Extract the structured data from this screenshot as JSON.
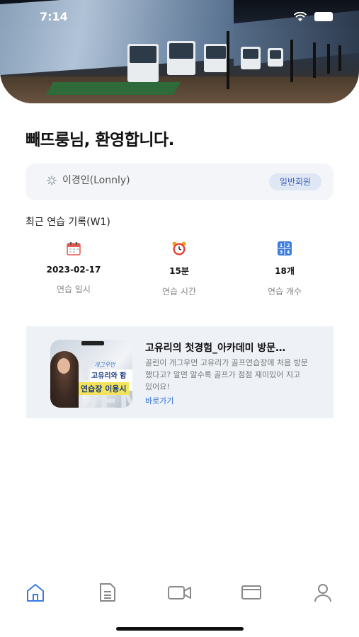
{
  "status_bar": {
    "time": "7:14",
    "wifi_icon": "wifi-icon",
    "battery_icon": "battery-icon"
  },
  "hero": {
    "image": "golf-practice-range-photo"
  },
  "greeting": "빼뜨룽님, 환영합니다.",
  "profile": {
    "name": "이경인(Lonnly)",
    "badge": "일반회원",
    "loading_icon": "spinner-icon"
  },
  "recent": {
    "title": "최근 연습 기록(W1)",
    "stats": [
      {
        "icon": "calendar-icon",
        "value": "2023-02-17",
        "label": "연습 일시"
      },
      {
        "icon": "alarm-clock-icon",
        "value": "15분",
        "label": "연습 시간"
      },
      {
        "icon": "numbers-icon",
        "value": "18개",
        "label": "연습 개수"
      }
    ]
  },
  "article": {
    "thumbnail": {
      "line1": "개그우먼",
      "line2": "고유리와 함께",
      "line3": "연습장 이용시"
    },
    "title": "고유리의 첫경험_아카데미 방문…",
    "description": "골린이 개그우먼 고유리가 골프연습장에 처음 방문했다고? 알면 알수록 골프가 점점 재미있어 지고 있어요!",
    "link": "바로가기"
  },
  "tabbar": {
    "items": [
      {
        "icon": "home-icon",
        "active": true
      },
      {
        "icon": "document-icon",
        "active": false
      },
      {
        "icon": "video-camera-icon",
        "active": false
      },
      {
        "icon": "card-icon",
        "active": false
      },
      {
        "icon": "user-icon",
        "active": false
      }
    ]
  },
  "colors": {
    "accent": "#3b7be0",
    "inactive": "#888888",
    "card_bg": "#eef1f6"
  }
}
